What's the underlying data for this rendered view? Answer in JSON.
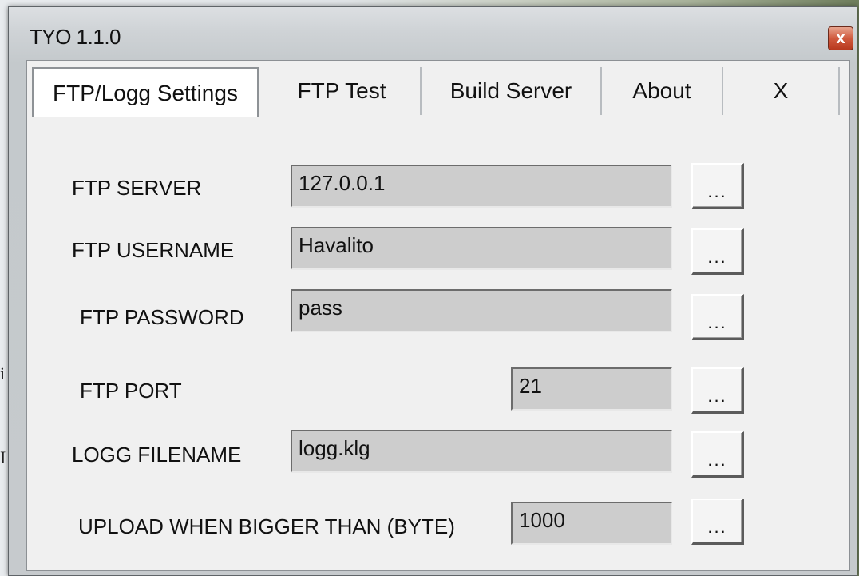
{
  "window": {
    "title": "TYO 1.1.0",
    "close_glyph": "x"
  },
  "tabs": [
    {
      "label": "FTP/Logg Settings",
      "active": true
    },
    {
      "label": "FTP Test",
      "active": false
    },
    {
      "label": "Build Server",
      "active": false
    },
    {
      "label": "About",
      "active": false
    },
    {
      "label": "X",
      "active": false
    }
  ],
  "settings": {
    "server": {
      "label": "FTP SERVER",
      "value": "127.0.0.1",
      "button": "..."
    },
    "username": {
      "label": "FTP USERNAME",
      "value": "Havalito",
      "button": "..."
    },
    "password": {
      "label": "FTP PASSWORD",
      "value": "pass",
      "button": "..."
    },
    "port": {
      "label": "FTP PORT",
      "value": "21",
      "button": "..."
    },
    "logg_filename": {
      "label": "LOGG FILENAME",
      "value": "logg.klg",
      "button": "..."
    },
    "upload_threshold": {
      "label": "UPLOAD WHEN BIGGER THAN (BYTE)",
      "value": "1000",
      "button": "..."
    }
  }
}
